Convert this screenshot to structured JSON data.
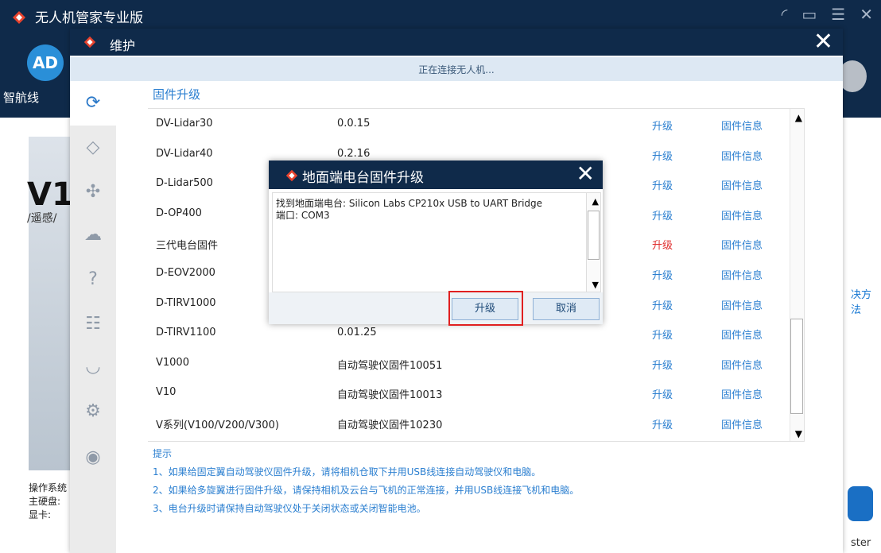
{
  "app": {
    "title": "无人机管家专业版",
    "nav_label": "智航线",
    "avatar_text": "AD"
  },
  "background": {
    "banner_title": "V1(",
    "banner_sub": "/遥感/",
    "info_lines": [
      "操作系统",
      "主硬盘:",
      "显卡:"
    ],
    "right_text": "决方法",
    "right_bottom": "ster"
  },
  "maintenance": {
    "title": "维护",
    "status": "正在连接无人机...",
    "section_title": "固件升级",
    "rows": [
      {
        "name": "DV-Lidar30",
        "version": "0.0.15",
        "upgrade": "升级",
        "info": "固件信息",
        "upgrade_red": false
      },
      {
        "name": "DV-Lidar40",
        "version": "0.2.16",
        "upgrade": "升级",
        "info": "固件信息",
        "upgrade_red": false
      },
      {
        "name": "D-Lidar500",
        "version": "",
        "upgrade": "升级",
        "info": "固件信息",
        "upgrade_red": false
      },
      {
        "name": "D-OP400",
        "version": "",
        "upgrade": "升级",
        "info": "固件信息",
        "upgrade_red": false
      },
      {
        "name": "三代电台固件",
        "version": "",
        "upgrade": "升级",
        "info": "固件信息",
        "upgrade_red": true
      },
      {
        "name": "D-EOV2000",
        "version": "",
        "upgrade": "升级",
        "info": "固件信息",
        "upgrade_red": false
      },
      {
        "name": "D-TIRV1000",
        "version": "",
        "upgrade": "升级",
        "info": "固件信息",
        "upgrade_red": false
      },
      {
        "name": "D-TIRV1100",
        "version": "0.01.25",
        "upgrade": "升级",
        "info": "固件信息",
        "upgrade_red": false
      },
      {
        "name": "V1000",
        "version": "自动驾驶仪固件10051",
        "upgrade": "升级",
        "info": "固件信息",
        "upgrade_red": false
      },
      {
        "name": "V10",
        "version": "自动驾驶仪固件10013",
        "upgrade": "升级",
        "info": "固件信息",
        "upgrade_red": false
      },
      {
        "name": "V系列(V100/V200/V300)",
        "version": "自动驾驶仪固件10230",
        "upgrade": "升级",
        "info": "固件信息",
        "upgrade_red": false
      }
    ],
    "tips_title": "提示",
    "tips": [
      "1、如果给固定翼自动驾驶仪固件升级，请将相机仓取下并用USB线连接自动驾驶仪和电脑。",
      "2、如果给多旋翼进行固件升级，请保持相机及云台与飞机的正常连接，并用USB线连接飞机和电脑。",
      "3、电台升级时请保持自动驾驶仪处于关闭状态或关闭智能电池。"
    ]
  },
  "modal": {
    "title": "地面端电台固件升级",
    "log_line1": "找到地面端电台: Silicon Labs CP210x USB to UART Bridge",
    "log_line2": "端口: COM3",
    "upgrade_label": "升级",
    "cancel_label": "取消"
  },
  "colors": {
    "titlebar": "#0f2a4a",
    "link": "#2b7fd0",
    "alert": "#e03030"
  }
}
